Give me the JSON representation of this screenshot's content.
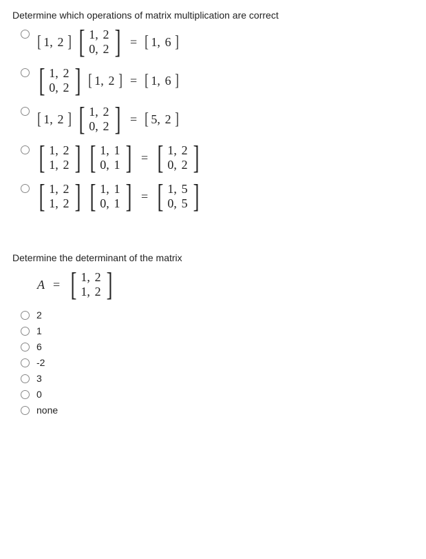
{
  "q1": {
    "prompt": "Determine which operations of matrix multiplication are correct",
    "options": [
      {
        "A": [
          [
            "1,",
            "2"
          ]
        ],
        "Asmall": true,
        "B": [
          [
            "1,",
            "2"
          ],
          [
            "0,",
            "2"
          ]
        ],
        "eq": "=",
        "C": [
          [
            "1,",
            "6"
          ]
        ],
        "Csmall": true
      },
      {
        "A": [
          [
            "1,",
            "2"
          ],
          [
            "0,",
            "2"
          ]
        ],
        "B": [
          [
            "1,",
            "2"
          ]
        ],
        "Bsmall": true,
        "eq": "=",
        "C": [
          [
            "1,",
            "6"
          ]
        ],
        "Csmall": true
      },
      {
        "A": [
          [
            "1,",
            "2"
          ]
        ],
        "Asmall": true,
        "B": [
          [
            "1,",
            "2"
          ],
          [
            "0,",
            "2"
          ]
        ],
        "eq": "=",
        "C": [
          [
            "5,",
            "2"
          ]
        ],
        "Csmall": true
      },
      {
        "A": [
          [
            "1,",
            "2"
          ],
          [
            "1,",
            "2"
          ]
        ],
        "B": [
          [
            "1,",
            "1"
          ],
          [
            "0,",
            "1"
          ]
        ],
        "eq": "=",
        "C": [
          [
            "1,",
            "2"
          ],
          [
            "0,",
            "2"
          ]
        ]
      },
      {
        "A": [
          [
            "1,",
            "2"
          ],
          [
            "1,",
            "2"
          ]
        ],
        "B": [
          [
            "1,",
            "1"
          ],
          [
            "0,",
            "1"
          ]
        ],
        "eq": "=",
        "C": [
          [
            "1,",
            "5"
          ],
          [
            "0,",
            "5"
          ]
        ]
      }
    ]
  },
  "q2": {
    "prompt": "Determine the determinant of the matrix",
    "lhs": "A",
    "equals": "=",
    "matrix": [
      [
        "1,",
        "2"
      ],
      [
        "1,",
        "2"
      ]
    ],
    "options": [
      "2",
      "1",
      "6",
      "-2",
      "3",
      "0",
      "none"
    ]
  }
}
